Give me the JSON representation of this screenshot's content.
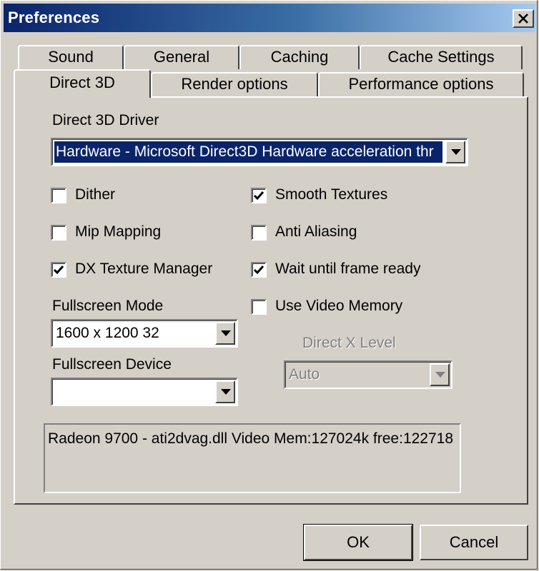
{
  "window": {
    "title": "Preferences"
  },
  "tabs": {
    "row_back": [
      "Sound",
      "General",
      "Caching",
      "Cache Settings"
    ],
    "row_front": [
      "Direct 3D",
      "Render options",
      "Performance options"
    ],
    "active": "Direct 3D"
  },
  "direct3d": {
    "driver_label": "Direct 3D Driver",
    "driver_value": "Hardware - Microsoft Direct3D Hardware acceleration thr",
    "checkboxes": {
      "dither": {
        "label": "Dither",
        "checked": false
      },
      "mip_mapping": {
        "label": "Mip Mapping",
        "checked": false
      },
      "dx_texture_manager": {
        "label": "DX Texture Manager",
        "checked": true
      },
      "smooth_textures": {
        "label": "Smooth Textures",
        "checked": true
      },
      "anti_aliasing": {
        "label": "Anti Aliasing",
        "checked": false
      },
      "wait_until_frame_ready": {
        "label": "Wait until frame ready",
        "checked": true
      },
      "use_video_memory": {
        "label": "Use Video Memory",
        "checked": false
      }
    },
    "fullscreen_mode_label": "Fullscreen Mode",
    "fullscreen_mode_value": "1600 x 1200  32",
    "fullscreen_device_label": "Fullscreen Device",
    "fullscreen_device_value": "",
    "directx_level_label": "Direct X Level",
    "directx_level_value": "Auto",
    "info_text": "Radeon 9700 - ati2dvag.dll Video Mem:127024k free:122718"
  },
  "buttons": {
    "ok": "OK",
    "cancel": "Cancel"
  },
  "icons": {
    "close": "close-icon",
    "dropdown": "chevron-down-icon",
    "check": "checkmark-icon"
  },
  "colors": {
    "face": "#d4d0c8",
    "title_start": "#0a246a",
    "title_end": "#a6caf0",
    "selection": "#0a246a"
  }
}
